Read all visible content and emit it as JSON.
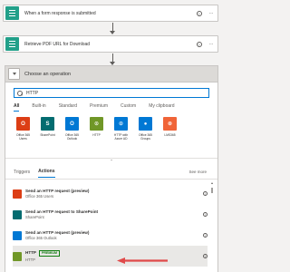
{
  "flow": {
    "step1_title": "When a form response is submitted",
    "step2_title": "Retrieve PDF URL for Download",
    "help_glyph": "?",
    "more_glyph": "···"
  },
  "panel": {
    "title": "Choose an operation",
    "search_value": "HTTP",
    "filter_tabs": [
      "All",
      "Built-in",
      "Standard",
      "Premium",
      "Custom",
      "My clipboard"
    ],
    "connectors": [
      {
        "label": "Office 365 Users",
        "color": "#dc3e15",
        "glyph": "O"
      },
      {
        "label": "SharePoint",
        "color": "#036c70",
        "glyph": "S"
      },
      {
        "label": "Office 365 Outlook",
        "color": "#0078d4",
        "glyph": "O"
      },
      {
        "label": "HTTP",
        "color": "#709727",
        "glyph": "⊙"
      },
      {
        "label": "HTTP with Azure AD",
        "color": "#0078d4",
        "glyph": "⊙"
      },
      {
        "label": "Office 365 Groups",
        "color": "#0078d4",
        "glyph": "●"
      },
      {
        "label": "LMS365",
        "color": "#f06438",
        "glyph": "⊛"
      }
    ],
    "collapse_glyph": "⌃",
    "sub_tabs": [
      "Triggers",
      "Actions"
    ],
    "see_more": "See more",
    "actions": [
      {
        "title": "Send an HTTP request (preview)",
        "subtitle": "Office 365 Users",
        "color": "#dc3e15",
        "badge": ""
      },
      {
        "title": "Send an HTTP request to SharePoint",
        "subtitle": "SharePoint",
        "color": "#036c70",
        "badge": ""
      },
      {
        "title": "Send an HTTP request (preview)",
        "subtitle": "Office 365 Outlook",
        "color": "#0078d4",
        "badge": ""
      },
      {
        "title": "HTTP",
        "subtitle": "HTTP",
        "color": "#709727",
        "badge": "PREMIUM"
      }
    ],
    "info_glyph": "i"
  },
  "colors": {
    "accent": "#0078d4",
    "flow_step": "#22a089",
    "pointer_arrow": "#e04a4a"
  }
}
